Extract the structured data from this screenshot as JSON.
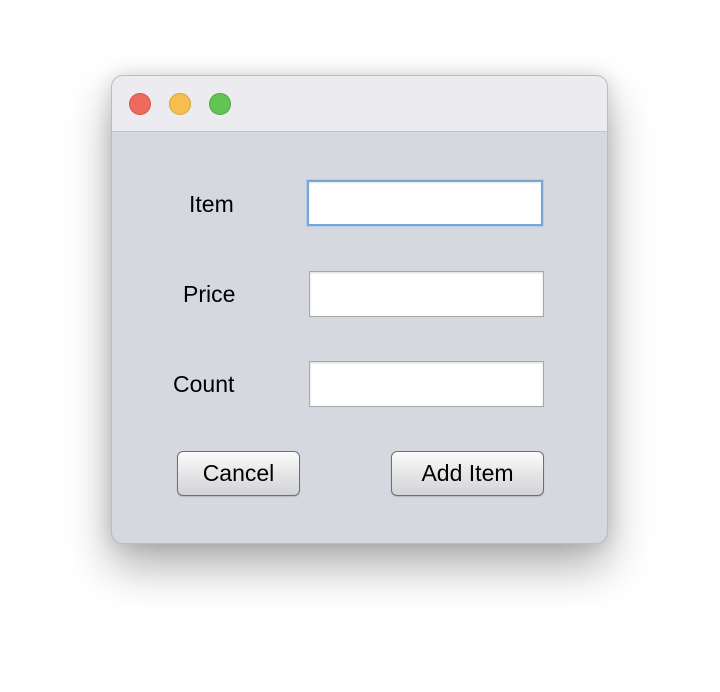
{
  "window": {
    "buttons": {
      "close": "close",
      "minimize": "minimize",
      "zoom": "zoom"
    }
  },
  "form": {
    "item_label": "Item",
    "item_value": "",
    "price_label": "Price",
    "price_value": "",
    "count_label": "Count",
    "count_value": "",
    "cancel_label": "Cancel",
    "add_label": "Add Item"
  },
  "colors": {
    "close": "#ed6a5e",
    "minimize": "#f5bf4f",
    "zoom": "#61c554",
    "focus_ring": "#7aa6d6",
    "window_bg": "#d5d8df"
  }
}
